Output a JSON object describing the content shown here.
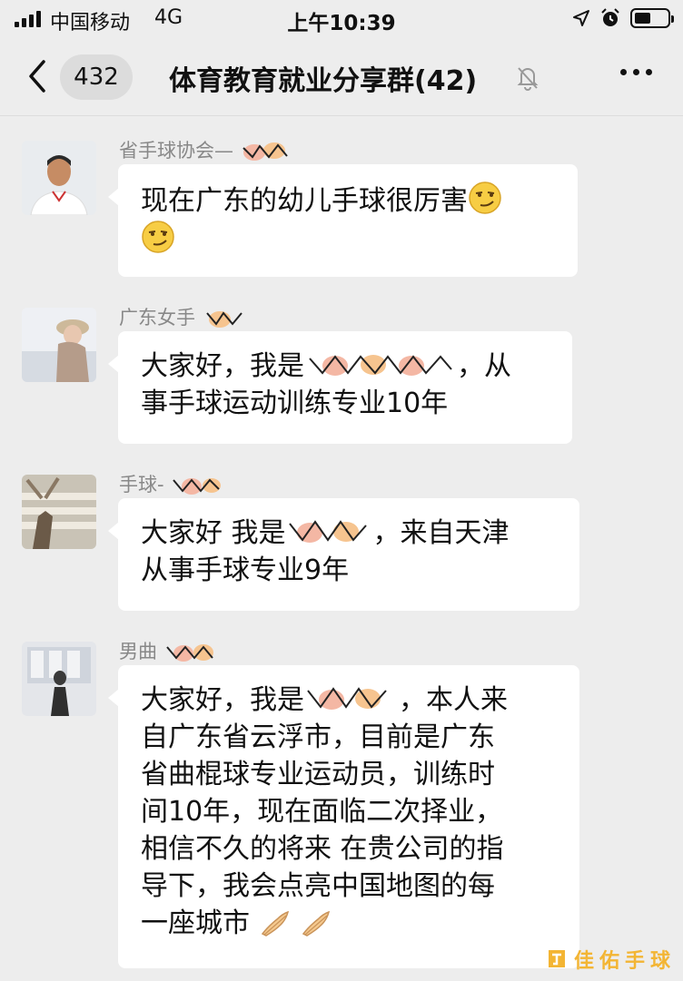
{
  "status_bar": {
    "carrier": "中国移动",
    "network": "4G",
    "time": "上午10:39",
    "icons": [
      "location-arrow-icon",
      "alarm-clock-icon",
      "battery-icon"
    ]
  },
  "nav": {
    "back_icon": "chevron-left-icon",
    "unread_count": "432",
    "title": "体育教育就业分享群(42)",
    "mute_icon": "bell-slash-icon",
    "more_icon": "more-dots-icon"
  },
  "messages": [
    {
      "sender": "省手球协会—",
      "lines": [
        "现在广东的幼儿手球很厉害",
        ""
      ],
      "emojis": [
        "smirk-emoji",
        "smirk-emoji"
      ]
    },
    {
      "sender": "广东女手",
      "lines": [
        "大家好，我是",
        "，从",
        "事手球运动训练专业10年"
      ]
    },
    {
      "sender": "手球-",
      "lines": [
        "大家好 我是",
        "，来自天津",
        "从事手球专业9年"
      ]
    },
    {
      "sender": "男曲",
      "lines": [
        "大家好，我是",
        "，本人来",
        "自广东省云浮市，目前是广东",
        "省曲棍球专业运动员，训练时",
        "间10年，现在面临二次择业，",
        "相信不久的将来 在贵公司的指",
        "导下，我会点亮中国地图的每",
        "一座城市"
      ],
      "emojis": [
        "folded-hands-emoji",
        "folded-hands-emoji"
      ]
    }
  ],
  "watermark": {
    "text": "佳佑手球",
    "color": "#f3b534"
  },
  "colors": {
    "background": "#ededed",
    "bubble": "#ffffff",
    "sender_text": "#888888"
  }
}
